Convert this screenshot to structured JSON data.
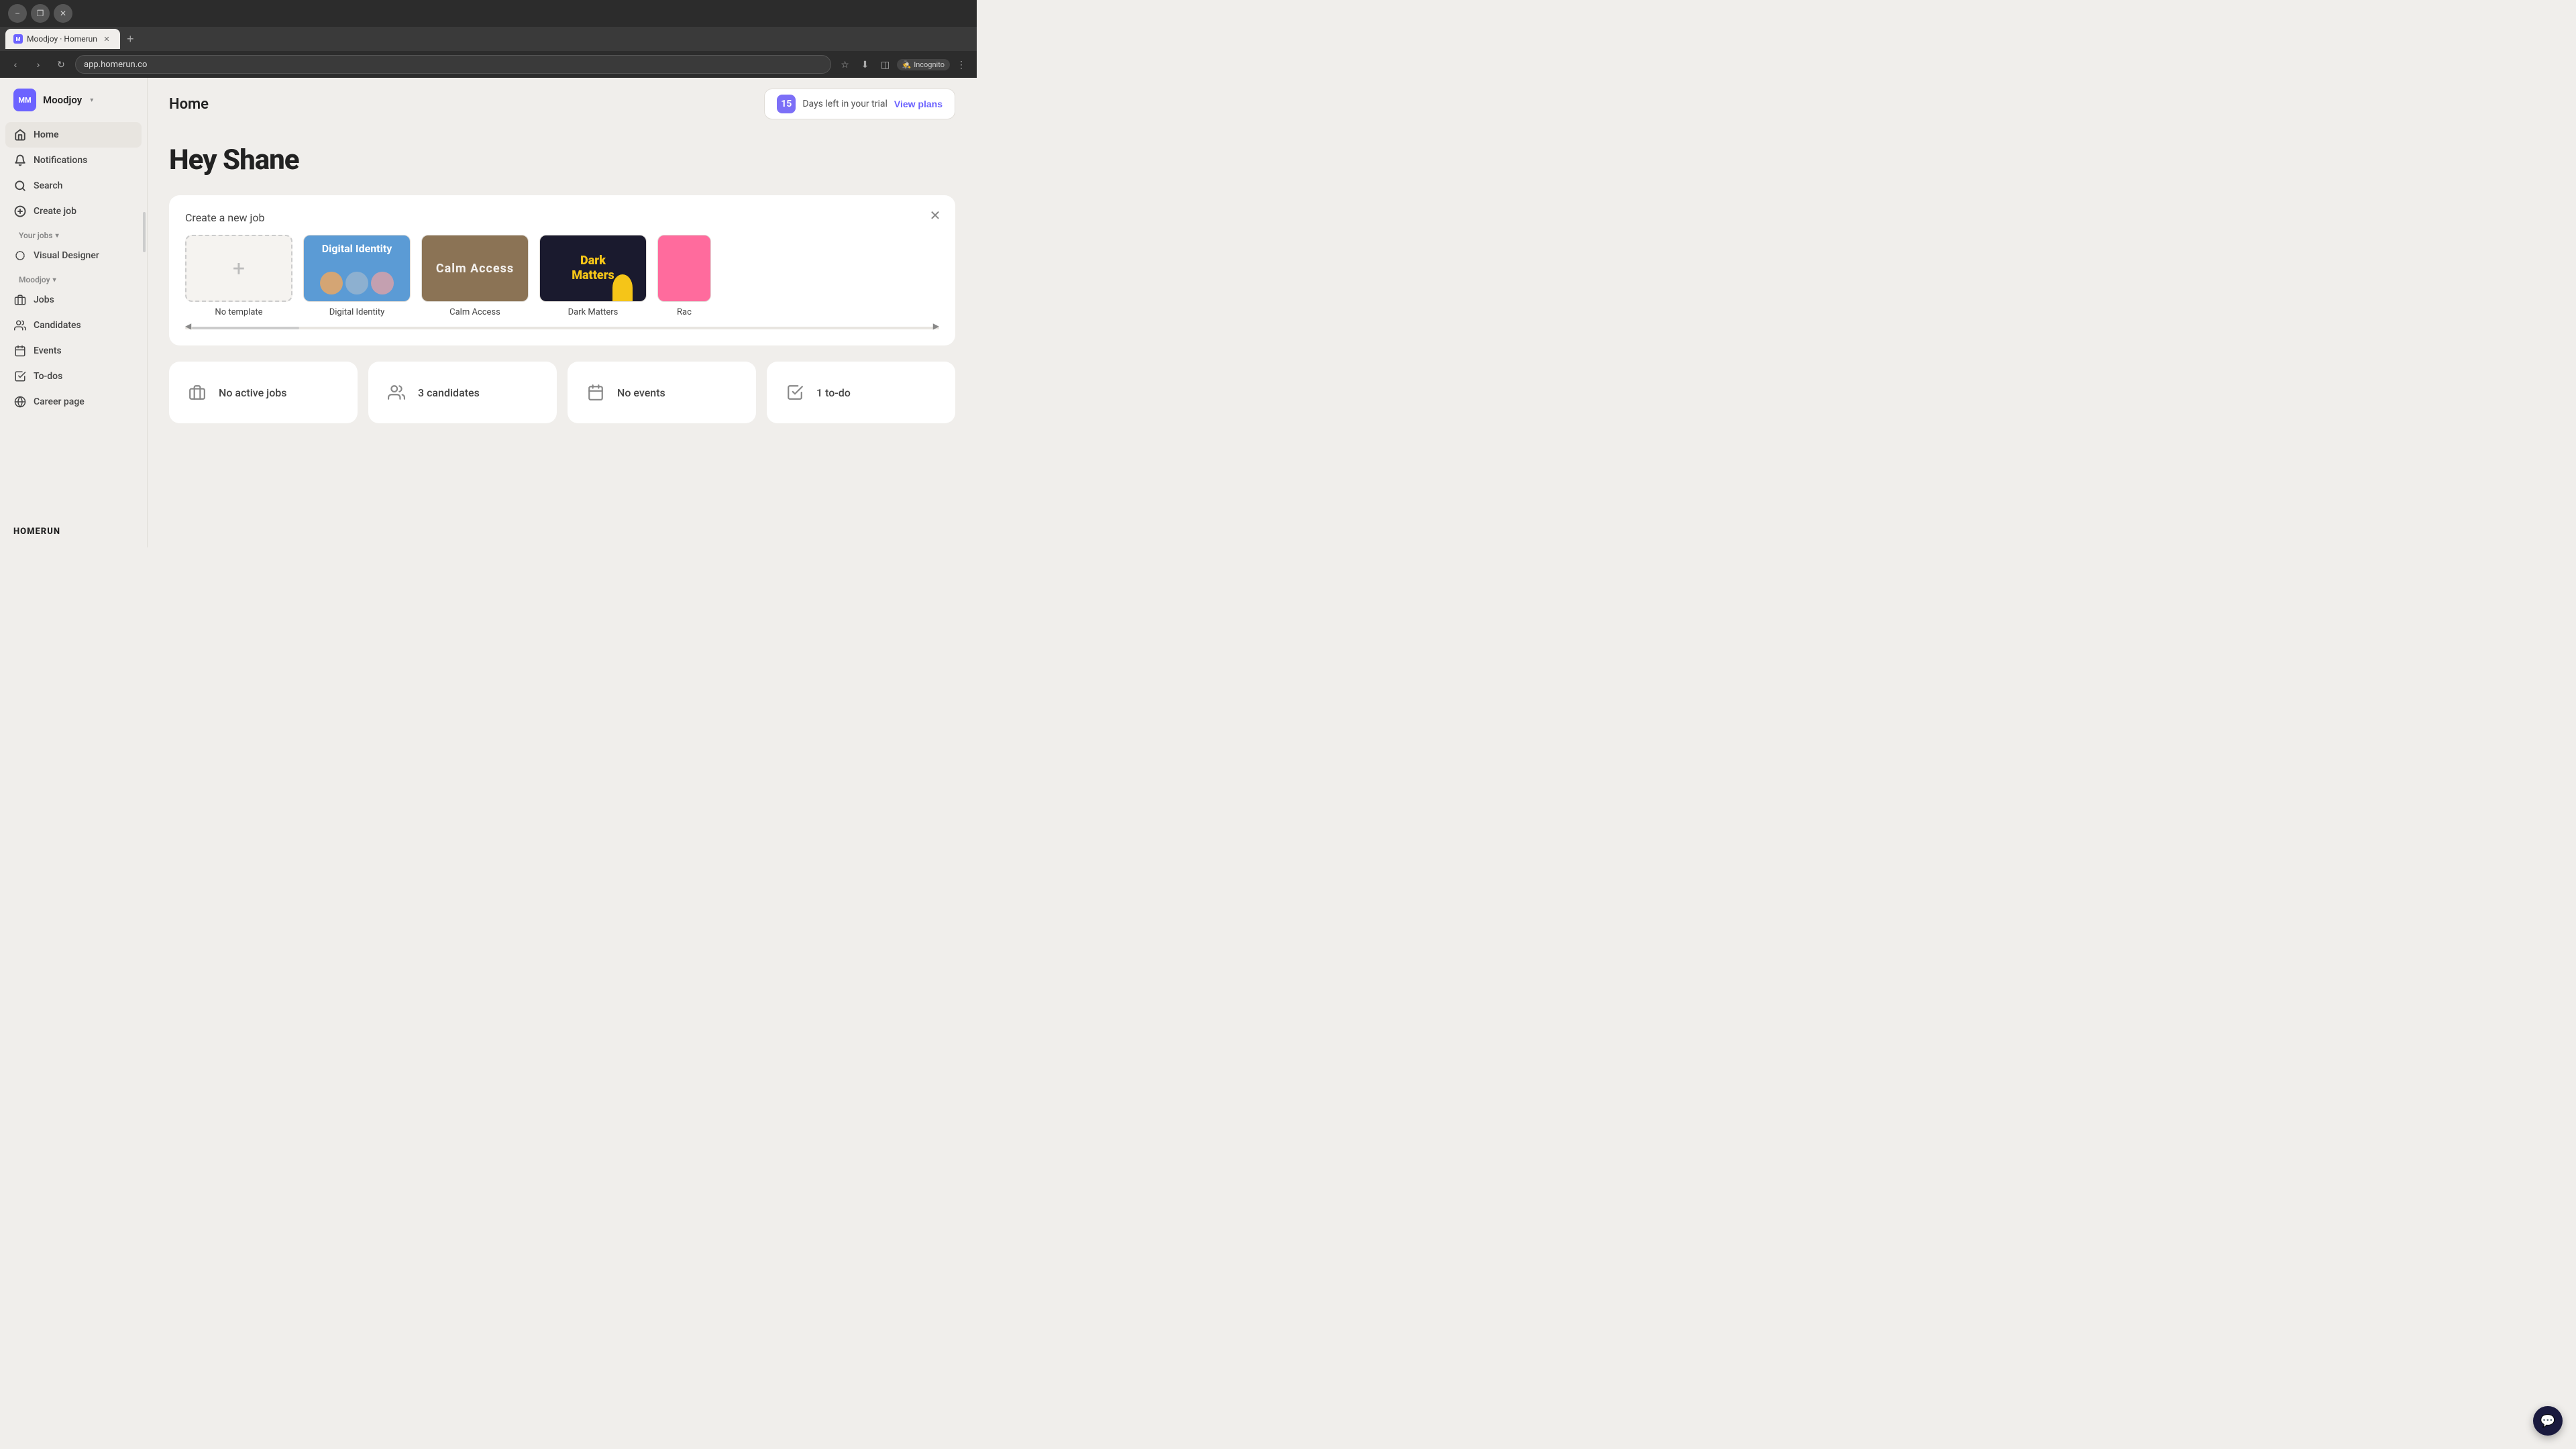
{
  "browser": {
    "tab_title": "Moodjoy · Homerun",
    "tab_new_label": "+",
    "url": "app.homerun.co",
    "back_btn": "‹",
    "forward_btn": "›",
    "refresh_btn": "↻",
    "incognito_label": "Incognito",
    "minimize_label": "−",
    "maximize_label": "❐",
    "close_label": "✕",
    "window_close": "✕"
  },
  "sidebar": {
    "avatar_initials": "MM",
    "org_name": "Moodjoy",
    "nav_items": [
      {
        "id": "home",
        "label": "Home",
        "active": true
      },
      {
        "id": "notifications",
        "label": "Notifications",
        "active": false
      },
      {
        "id": "search",
        "label": "Search",
        "active": false
      },
      {
        "id": "create-job",
        "label": "Create job",
        "active": false
      }
    ],
    "your_jobs_label": "Your jobs",
    "visual_designer_label": "Visual Designer",
    "moodjoy_section_label": "Moodjoy",
    "moodjoy_nav_items": [
      {
        "id": "jobs",
        "label": "Jobs"
      },
      {
        "id": "candidates",
        "label": "Candidates"
      },
      {
        "id": "events",
        "label": "Events"
      },
      {
        "id": "todos",
        "label": "To-dos"
      },
      {
        "id": "career-page",
        "label": "Career page"
      }
    ],
    "logo_text": "HOMERUN"
  },
  "header": {
    "page_title": "Home",
    "trial_number": "15",
    "trial_text": "Days left in your trial",
    "view_plans_label": "View plans"
  },
  "main": {
    "greeting": "Hey Shane",
    "create_job_section": {
      "title": "Create a new job",
      "close_btn_label": "✕",
      "templates": [
        {
          "id": "no-template",
          "label": "No template",
          "type": "empty",
          "plus": "+"
        },
        {
          "id": "digital-identity",
          "label": "Digital Identity",
          "type": "digital-identity"
        },
        {
          "id": "calm-access",
          "label": "Calm Access",
          "type": "calm-access",
          "text": "Calm Access"
        },
        {
          "id": "dark-matters",
          "label": "Dark Matters",
          "type": "dark-matters",
          "line1": "Dark",
          "line2": "Matters"
        },
        {
          "id": "rac",
          "label": "Rac",
          "type": "partial"
        }
      ]
    },
    "stats": [
      {
        "id": "jobs",
        "label": "No active jobs",
        "icon": "briefcase"
      },
      {
        "id": "candidates",
        "label": "3 candidates",
        "icon": "people"
      },
      {
        "id": "events",
        "label": "No events",
        "icon": "calendar"
      },
      {
        "id": "todos",
        "label": "1 to-do",
        "icon": "checkbox"
      }
    ]
  },
  "chat": {
    "icon": "💬"
  }
}
